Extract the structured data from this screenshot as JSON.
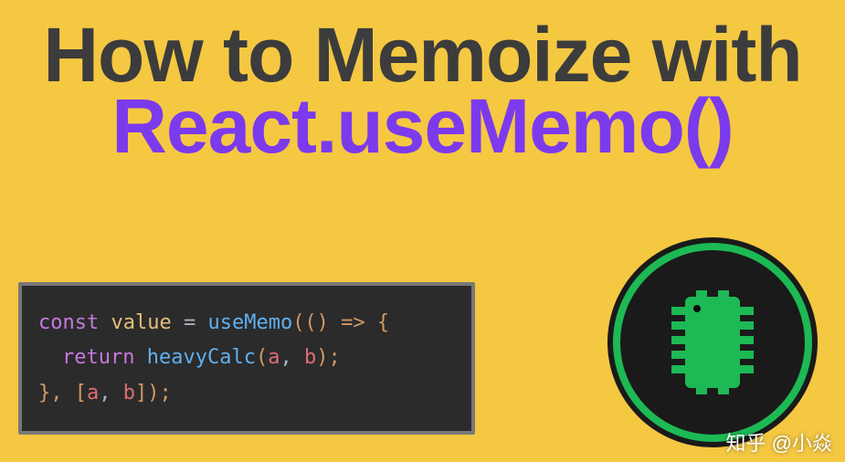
{
  "title": {
    "line1": "How to Memoize with",
    "line2": "React.useMemo()"
  },
  "code": {
    "kw_const": "const",
    "var_value": "value",
    "eq": " = ",
    "fn_useMemo": "useMemo",
    "arrow_open": "(() => {",
    "kw_return": "return",
    "fn_heavyCalc": "heavyCalc",
    "args_open": "(",
    "arg_a": "a",
    "comma1": ", ",
    "arg_b": "b",
    "args_close": ");",
    "close_brace": "}, ",
    "deps_open": "[",
    "dep_a": "a",
    "comma2": ", ",
    "dep_b": "b",
    "deps_close": "]);"
  },
  "watermark": "知乎 @小焱",
  "colors": {
    "background": "#f5c842",
    "title_dark": "#3c3c3c",
    "title_accent": "#7c3aed",
    "code_bg": "#2b2b2b",
    "chip_green": "#1db954"
  }
}
